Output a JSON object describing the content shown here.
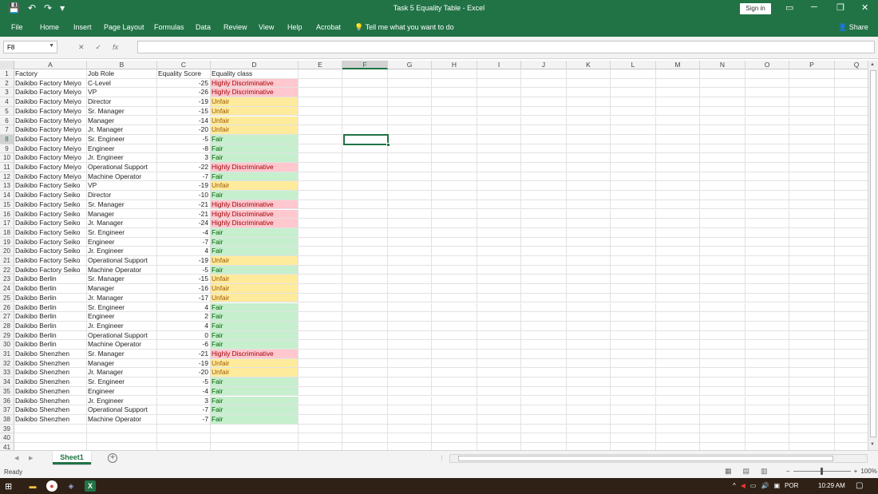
{
  "window": {
    "title": "Task 5 Equality Table  -  Excel",
    "sign_in": "Sign in"
  },
  "menu": {
    "items": [
      "File",
      "Home",
      "Insert",
      "Page Layout",
      "Formulas",
      "Data",
      "Review",
      "View",
      "Help",
      "Acrobat"
    ],
    "tell_me": "Tell me what you want to do",
    "share": "Share"
  },
  "formula_bar": {
    "name_box": "F8",
    "fx": "fx",
    "cancel": "✕",
    "enter": "✓",
    "value": ""
  },
  "columns": [
    "A",
    "B",
    "C",
    "D",
    "E",
    "F",
    "G",
    "H",
    "I",
    "J",
    "K",
    "L",
    "M",
    "N",
    "O",
    "P",
    "Q"
  ],
  "selected": {
    "column": "F",
    "row": 8,
    "cell": "F8"
  },
  "headers": {
    "factory": "Factory",
    "job_role": "Job Role",
    "score": "Equality Score",
    "class": "Equality class"
  },
  "table": [
    [
      "Daikibo Factory Meiyo",
      "C-Level",
      -25,
      "Highly Discriminative"
    ],
    [
      "Daikibo Factory Meiyo",
      "VP",
      -26,
      "Highly Discriminative"
    ],
    [
      "Daikibo Factory Meiyo",
      "Director",
      -19,
      "Unfair"
    ],
    [
      "Daikibo Factory Meiyo",
      "Sr. Manager",
      -15,
      "Unfair"
    ],
    [
      "Daikibo Factory Meiyo",
      "Manager",
      -14,
      "Unfair"
    ],
    [
      "Daikibo Factory Meiyo",
      "Jr. Manager",
      -20,
      "Unfair"
    ],
    [
      "Daikibo Factory Meiyo",
      "Sr. Engineer",
      -5,
      "Fair"
    ],
    [
      "Daikibo Factory Meiyo",
      "Engineer",
      -8,
      "Fair"
    ],
    [
      "Daikibo Factory Meiyo",
      "Jr. Engineer",
      3,
      "Fair"
    ],
    [
      "Daikibo Factory Meiyo",
      "Operational Support",
      -22,
      "Highly Discriminative"
    ],
    [
      "Daikibo Factory Meiyo",
      "Machine Operator",
      -7,
      "Fair"
    ],
    [
      "Daikibo Factory Seiko",
      "VP",
      -19,
      "Unfair"
    ],
    [
      "Daikibo Factory Seiko",
      "Director",
      -10,
      "Fair"
    ],
    [
      "Daikibo Factory Seiko",
      "Sr. Manager",
      -21,
      "Highly Discriminative"
    ],
    [
      "Daikibo Factory Seiko",
      "Manager",
      -21,
      "Highly Discriminative"
    ],
    [
      "Daikibo Factory Seiko",
      "Jr. Manager",
      -24,
      "Highly Discriminative"
    ],
    [
      "Daikibo Factory Seiko",
      "Sr. Engineer",
      -4,
      "Fair"
    ],
    [
      "Daikibo Factory Seiko",
      "Engineer",
      -7,
      "Fair"
    ],
    [
      "Daikibo Factory Seiko",
      "Jr. Engineer",
      4,
      "Fair"
    ],
    [
      "Daikibo Factory Seiko",
      "Operational Support",
      -19,
      "Unfair"
    ],
    [
      "Daikibo Factory Seiko",
      "Machine Operator",
      -5,
      "Fair"
    ],
    [
      "Daikibo Berlin",
      "Sr. Manager",
      -15,
      "Unfair"
    ],
    [
      "Daikibo Berlin",
      "Manager",
      -16,
      "Unfair"
    ],
    [
      "Daikibo Berlin",
      "Jr. Manager",
      -17,
      "Unfair"
    ],
    [
      "Daikibo Berlin",
      "Sr. Engineer",
      4,
      "Fair"
    ],
    [
      "Daikibo Berlin",
      "Engineer",
      2,
      "Fair"
    ],
    [
      "Daikibo Berlin",
      "Jr. Engineer",
      4,
      "Fair"
    ],
    [
      "Daikibo Berlin",
      "Operational Support",
      0,
      "Fair"
    ],
    [
      "Daikibo Berlin",
      "Machine Operator",
      -6,
      "Fair"
    ],
    [
      "Daikibo Shenzhen",
      "Sr. Manager",
      -21,
      "Highly Discriminative"
    ],
    [
      "Daikibo Shenzhen",
      "Manager",
      -19,
      "Unfair"
    ],
    [
      "Daikibo Shenzhen",
      "Jr. Manager",
      -20,
      "Unfair"
    ],
    [
      "Daikibo Shenzhen",
      "Sr. Engineer",
      -5,
      "Fair"
    ],
    [
      "Daikibo Shenzhen",
      "Engineer",
      -4,
      "Fair"
    ],
    [
      "Daikibo Shenzhen",
      "Jr. Engineer",
      3,
      "Fair"
    ],
    [
      "Daikibo Shenzhen",
      "Operational Support",
      -7,
      "Fair"
    ],
    [
      "Daikibo Shenzhen",
      "Machine Operator",
      -7,
      "Fair"
    ]
  ],
  "empty_rows": [
    39,
    40,
    41
  ],
  "sheet_tab": "Sheet1",
  "status": {
    "ready": "Ready",
    "zoom": "100%"
  },
  "taskbar": {
    "lang": "POR",
    "time": "10:29 AM"
  },
  "colors": {
    "excel_green": "#217346",
    "highly_discriminative": "#ffc7ce",
    "unfair": "#ffeb9c",
    "fair": "#c6efce"
  }
}
